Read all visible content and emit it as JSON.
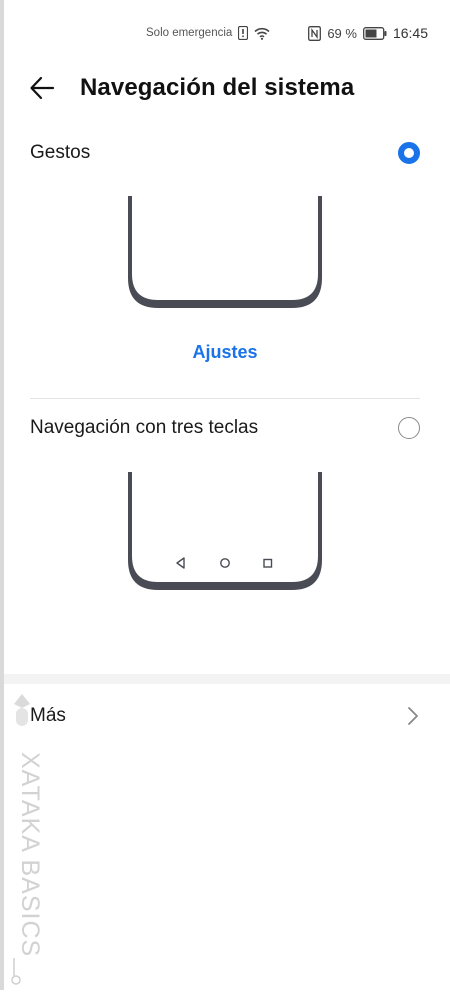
{
  "status_bar": {
    "emergency_text": "Solo emergencia",
    "battery_percent": "69 %",
    "time": "16:45",
    "icons": [
      "alert-icon",
      "wifi-icon",
      "nfc-icon",
      "battery-icon"
    ]
  },
  "header": {
    "title": "Navegación del sistema",
    "back_icon": "arrow-left-icon"
  },
  "options": [
    {
      "label": "Gestos",
      "selected": true
    },
    {
      "label": "Navegación con tres teclas",
      "selected": false
    }
  ],
  "gestures_settings_link": "Ajustes",
  "more": {
    "label": "Más",
    "icon": "chevron-right-icon"
  },
  "watermark": {
    "text": "XATAKA BASICS"
  },
  "colors": {
    "accent": "#1a73e8",
    "phone_outline": "#4a4c55"
  }
}
